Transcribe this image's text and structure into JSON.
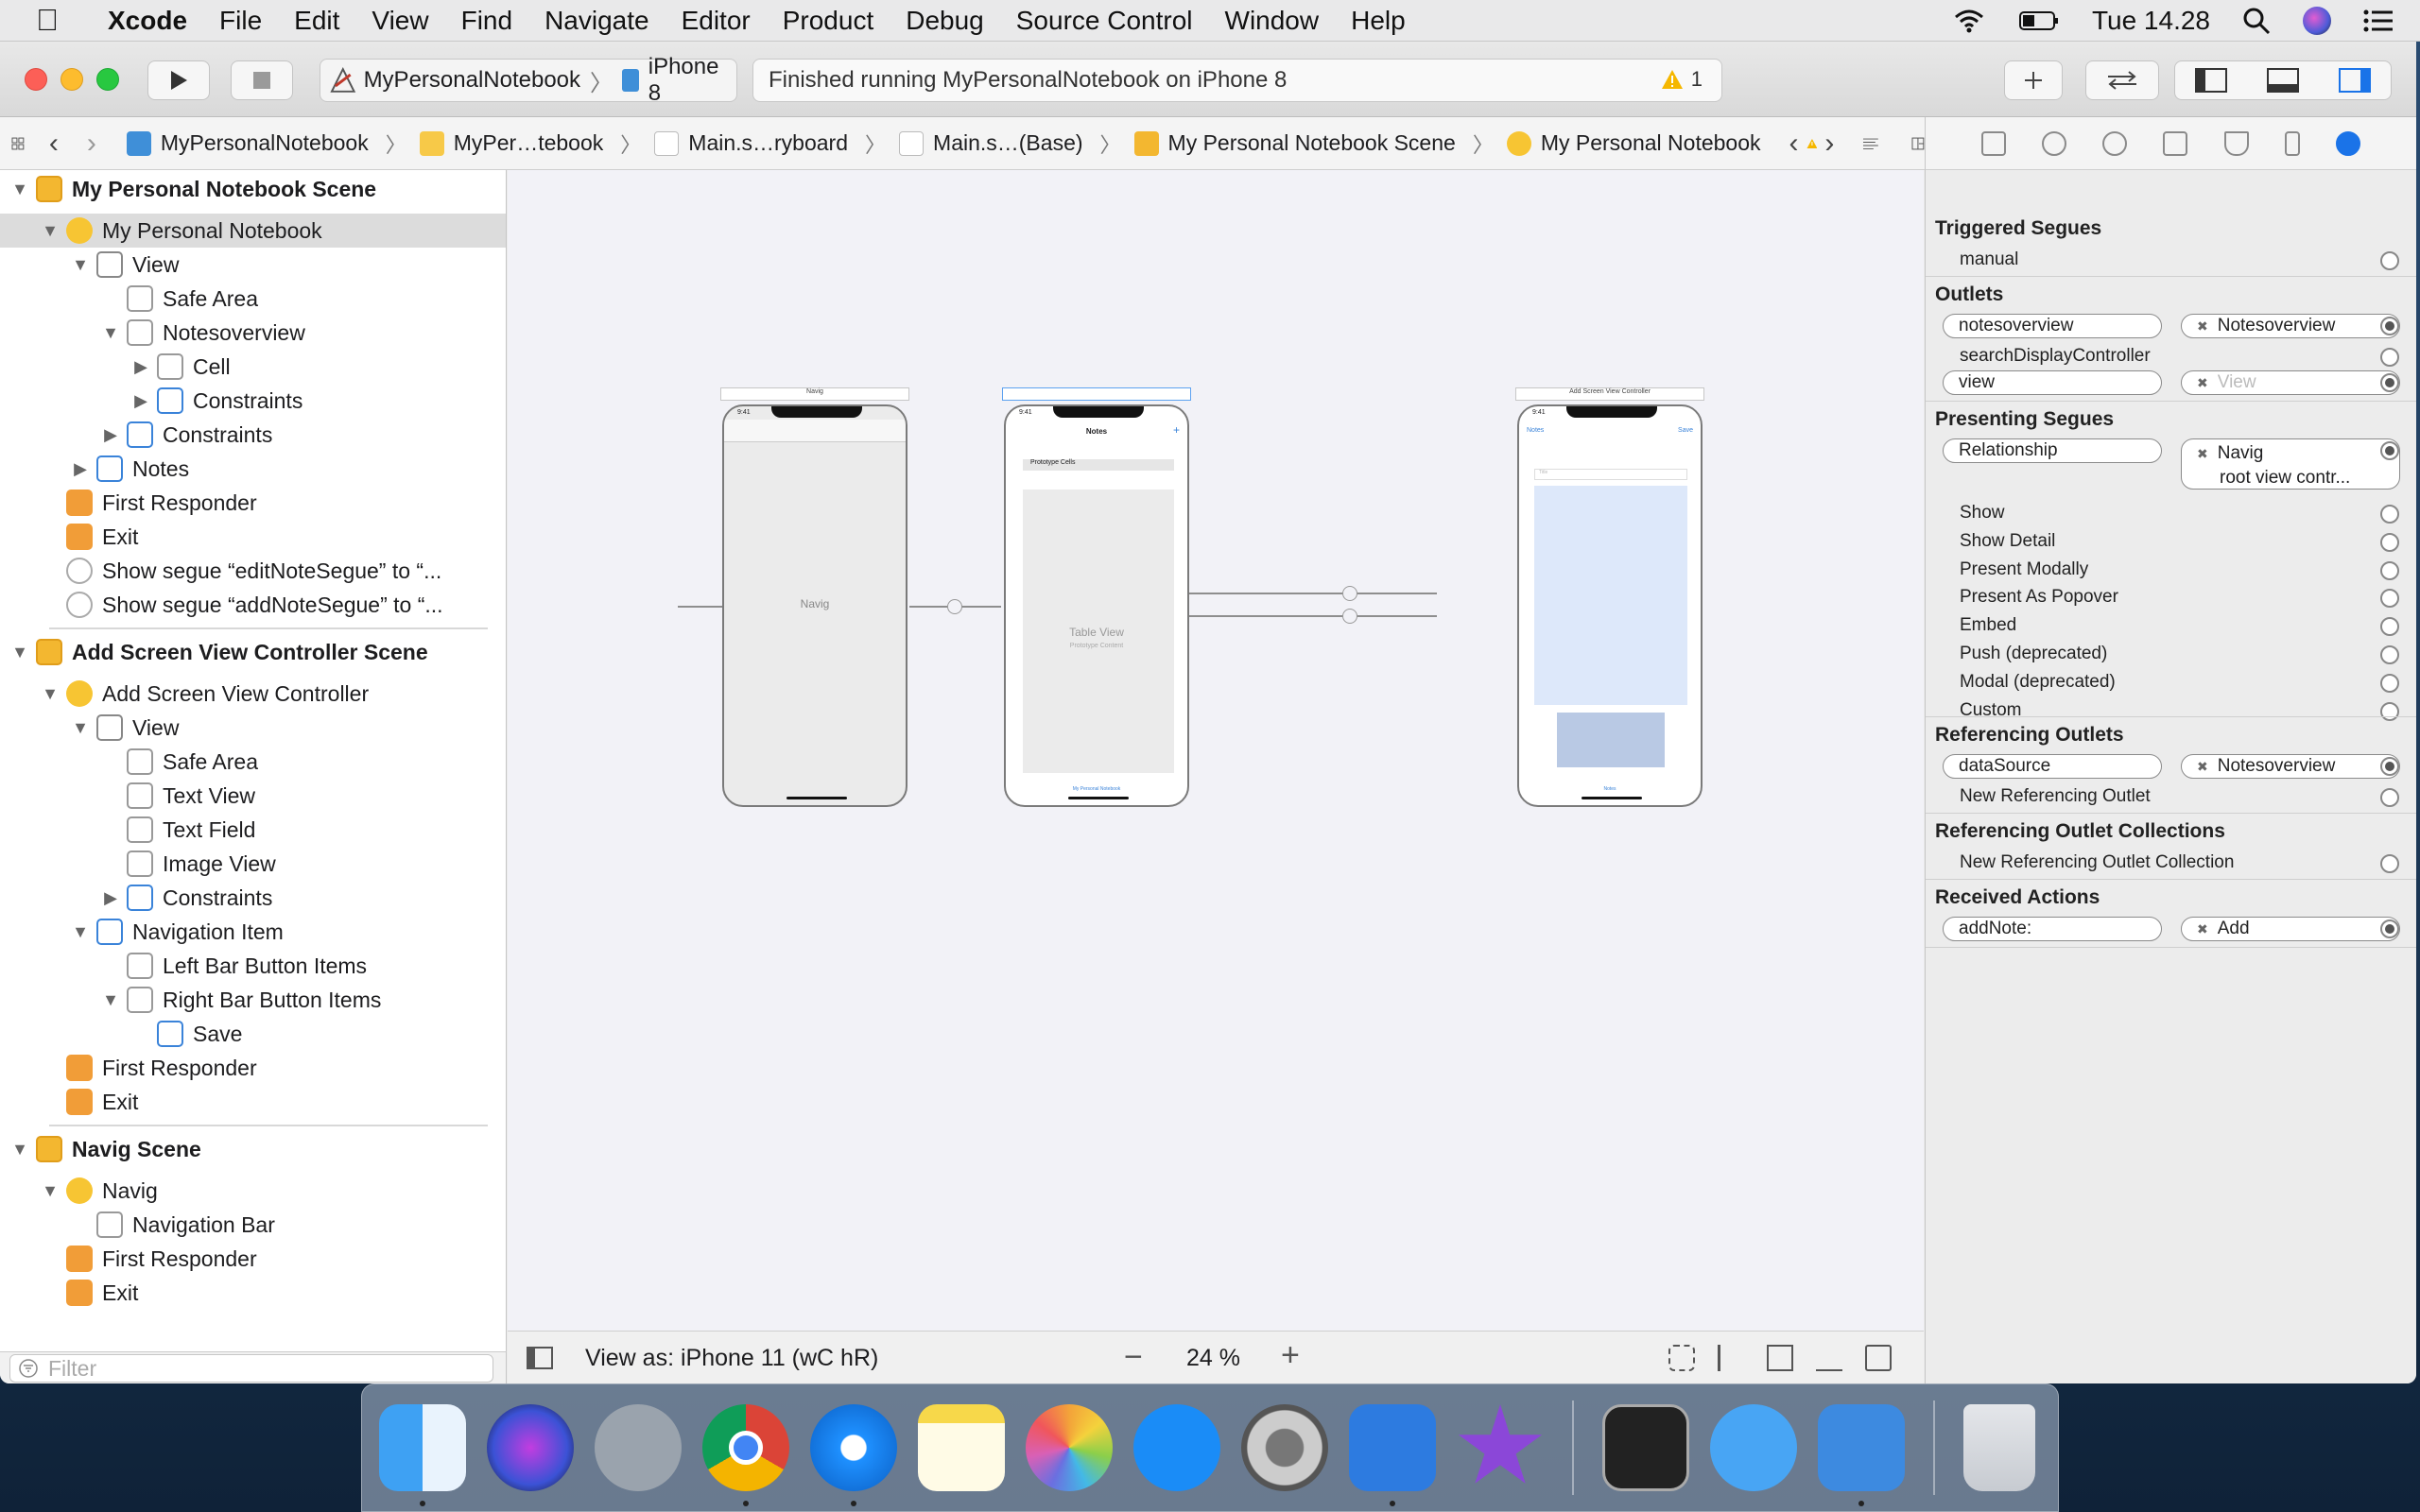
{
  "menubar": {
    "app": "Xcode",
    "items": [
      "File",
      "Edit",
      "View",
      "Find",
      "Navigate",
      "Editor",
      "Product",
      "Debug",
      "Source Control",
      "Window",
      "Help"
    ],
    "clock": "Tue 14.28"
  },
  "toolbar": {
    "scheme": "MyPersonalNotebook",
    "device": "iPhone 8",
    "activity": "Finished running MyPersonalNotebook on iPhone 8",
    "warning_count": "1"
  },
  "jumpbar": {
    "crumbs": [
      "MyPersonalNotebook",
      "MyPer…tebook",
      "Main.s…ryboard",
      "Main.s…(Base)",
      "My Personal Notebook Scene",
      "My Personal Notebook"
    ]
  },
  "outline": {
    "rows": [
      {
        "label": "My Personal Notebook Scene",
        "level": 0,
        "disc": "▼",
        "icon": "scene",
        "bold": true
      },
      {
        "label": "My Personal Notebook",
        "level": 1,
        "disc": "▼",
        "icon": "vc",
        "selected": true
      },
      {
        "label": "View",
        "level": 2,
        "disc": "▼",
        "icon": "view"
      },
      {
        "label": "Safe Area",
        "level": 3,
        "disc": "",
        "icon": "gray"
      },
      {
        "label": "Notesoverview",
        "level": 3,
        "disc": "▼",
        "icon": "gray"
      },
      {
        "label": "Cell",
        "level": 4,
        "disc": "▶",
        "icon": "gray"
      },
      {
        "label": "Constraints",
        "level": 4,
        "disc": "▶",
        "icon": "blue"
      },
      {
        "label": "Constraints",
        "level": 3,
        "disc": "▶",
        "icon": "blue"
      },
      {
        "label": "Notes",
        "level": 2,
        "disc": "▶",
        "icon": "blue"
      },
      {
        "label": "First Responder",
        "level": 1,
        "disc": "",
        "icon": "orange"
      },
      {
        "label": "Exit",
        "level": 1,
        "disc": "",
        "icon": "orange"
      },
      {
        "label": "Show segue “editNoteSegue” to “...",
        "level": 1,
        "disc": "",
        "icon": "seg"
      },
      {
        "label": "Show segue “addNoteSegue” to “...",
        "level": 1,
        "disc": "",
        "icon": "seg"
      },
      {
        "label": "Add Screen View Controller Scene",
        "level": 0,
        "disc": "▼",
        "icon": "scene",
        "bold": true
      },
      {
        "label": "Add Screen View Controller",
        "level": 1,
        "disc": "▼",
        "icon": "vc"
      },
      {
        "label": "View",
        "level": 2,
        "disc": "▼",
        "icon": "view"
      },
      {
        "label": "Safe Area",
        "level": 3,
        "disc": "",
        "icon": "gray"
      },
      {
        "label": "Text View",
        "level": 3,
        "disc": "",
        "icon": "gray"
      },
      {
        "label": "Text Field",
        "level": 3,
        "disc": "",
        "icon": "gray"
      },
      {
        "label": "Image View",
        "level": 3,
        "disc": "",
        "icon": "gray"
      },
      {
        "label": "Constraints",
        "level": 3,
        "disc": "▶",
        "icon": "blue"
      },
      {
        "label": "Navigation Item",
        "level": 2,
        "disc": "▼",
        "icon": "blue"
      },
      {
        "label": "Left Bar Button Items",
        "level": 3,
        "disc": "",
        "icon": "gray"
      },
      {
        "label": "Right Bar Button Items",
        "level": 3,
        "disc": "▼",
        "icon": "gray"
      },
      {
        "label": "Save",
        "level": 4,
        "disc": "",
        "icon": "blue"
      },
      {
        "label": "First Responder",
        "level": 1,
        "disc": "",
        "icon": "orange"
      },
      {
        "label": "Exit",
        "level": 1,
        "disc": "",
        "icon": "orange"
      },
      {
        "label": "Navig Scene",
        "level": 0,
        "disc": "▼",
        "icon": "scene",
        "bold": true
      },
      {
        "label": "Navig",
        "level": 1,
        "disc": "▼",
        "icon": "vc"
      },
      {
        "label": "Navigation Bar",
        "level": 2,
        "disc": "",
        "icon": "gray"
      },
      {
        "label": "First Responder",
        "level": 1,
        "disc": "",
        "icon": "orange"
      },
      {
        "label": "Exit",
        "level": 1,
        "disc": "",
        "icon": "orange"
      }
    ],
    "filter_placeholder": "Filter"
  },
  "canvas": {
    "scene1_title": "Navig",
    "scene1_label": "Navig",
    "scene2_title": "Notes",
    "scene2_proto": "Prototype Cells",
    "scene2_table": "Table View",
    "scene2_table_sub": "Prototype Content",
    "scene2_tab": "My Personal Notebook",
    "scene3_title": "Add Screen View Controller",
    "scene3_back": "Notes",
    "scene3_save": "Save",
    "scene3_field": "Title",
    "scene3_tab": "Notes",
    "status_time": "9:41",
    "view_as": "View as: iPhone 11 (wC hR)",
    "zoom": "24 %"
  },
  "inspector": {
    "triggered": {
      "title": "Triggered Segues",
      "rows": [
        "manual"
      ]
    },
    "outlets": {
      "title": "Outlets",
      "rows": [
        {
          "name": "notesoverview",
          "target": "Notesoverview",
          "connected": true
        },
        {
          "name": "searchDisplayController",
          "target": "",
          "connected": false
        },
        {
          "name": "view",
          "target": "View",
          "connected": true,
          "dim": true
        }
      ]
    },
    "presenting": {
      "title": "Presenting Segues",
      "relationship": {
        "name": "Relationship",
        "target": "Navig",
        "target2": "root view contr..."
      },
      "rows": [
        "Show",
        "Show Detail",
        "Present Modally",
        "Present As Popover",
        "Embed",
        "Push (deprecated)",
        "Modal (deprecated)",
        "Custom"
      ]
    },
    "referencing": {
      "title": "Referencing Outlets",
      "connected": {
        "name": "dataSource",
        "target": "Notesoverview"
      },
      "new": "New Referencing Outlet"
    },
    "collections": {
      "title": "Referencing Outlet Collections",
      "new": "New Referencing Outlet Collection"
    },
    "actions": {
      "title": "Received Actions",
      "connected": {
        "name": "addNote:",
        "target": "Add"
      }
    }
  }
}
